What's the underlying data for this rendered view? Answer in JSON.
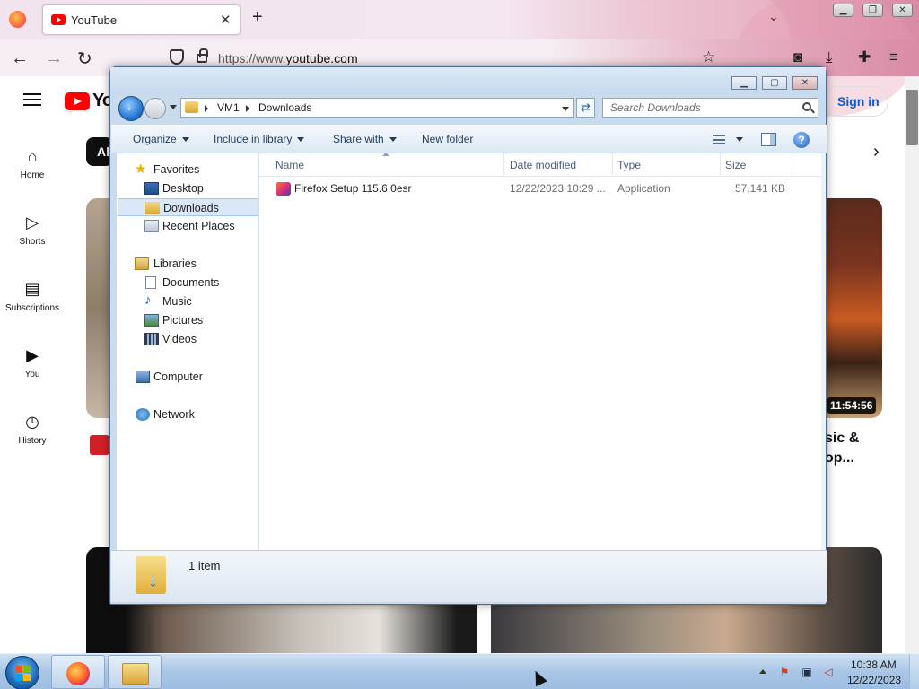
{
  "browser": {
    "tab_title": "YouTube",
    "url_host": "https://www.",
    "url_domain": "youtube.com"
  },
  "youtube": {
    "logo_text": "You",
    "chip_first": "Al",
    "sign_in": "Sign in",
    "nav": [
      {
        "label": "Home",
        "icon": "home-icon"
      },
      {
        "label": "Shorts",
        "icon": "shorts-icon"
      },
      {
        "label": "Subscriptions",
        "icon": "subscriptions-icon"
      },
      {
        "label": "You",
        "icon": "you-icon"
      },
      {
        "label": "History",
        "icon": "history-icon"
      }
    ],
    "video_duration": "11:54:56",
    "video_title_line1": "sic &",
    "video_title_line2": "op..."
  },
  "explorer": {
    "breadcrumb": [
      "VM1",
      "Downloads"
    ],
    "search_placeholder": "Search Downloads",
    "toolbar": {
      "organize": "Organize",
      "include_in_library": "Include in library",
      "share_with": "Share with",
      "new_folder": "New folder"
    },
    "nav": {
      "favorites": "Favorites",
      "desktop": "Desktop",
      "downloads": "Downloads",
      "recent_places": "Recent Places",
      "libraries": "Libraries",
      "documents": "Documents",
      "music": "Music",
      "pictures": "Pictures",
      "videos": "Videos",
      "computer": "Computer",
      "network": "Network"
    },
    "columns": [
      "Name",
      "Date modified",
      "Type",
      "Size"
    ],
    "files": [
      {
        "name": "Firefox Setup 115.6.0esr",
        "date": "12/22/2023 10:29 ...",
        "type": "Application",
        "size": "57,141 KB"
      }
    ],
    "status": "1 item"
  },
  "taskbar": {
    "time": "10:38 AM",
    "date": "12/22/2023"
  },
  "colors": {
    "youtube_red": "#ff0000",
    "explorer_frame": "#c9dcee",
    "selection": "#d9e7f8",
    "taskbar": "#a9c6e6"
  }
}
